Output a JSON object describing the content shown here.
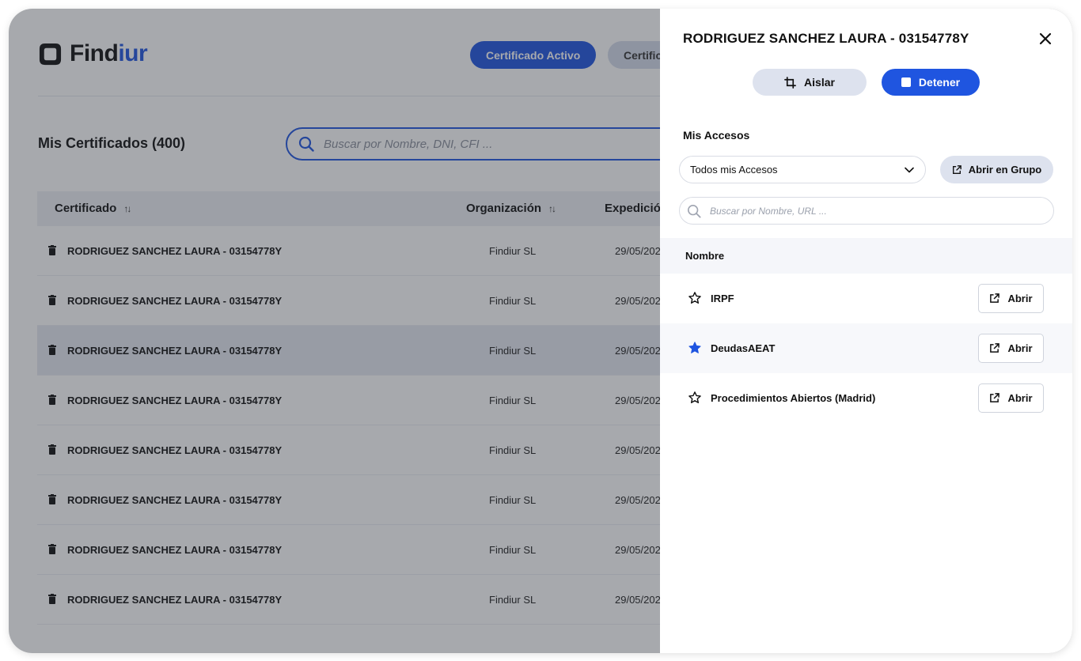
{
  "app": {
    "logo_prefix": "Find",
    "logo_suffix": "iur",
    "tabs": [
      "Certificado Activo",
      "Certific"
    ],
    "page_title": "Mis Certificados (400)",
    "search_placeholder": "Buscar por Nombre, DNI, CFI ...",
    "columns": [
      "Certificado",
      "Organización",
      "Expedición"
    ],
    "rows": [
      {
        "name": "RODRIGUEZ SANCHEZ LAURA - 03154778Y",
        "org": "Findiur SL",
        "date": "29/05/202"
      },
      {
        "name": "RODRIGUEZ SANCHEZ LAURA - 03154778Y",
        "org": "Findiur SL",
        "date": "29/05/202"
      },
      {
        "name": "RODRIGUEZ SANCHEZ LAURA - 03154778Y",
        "org": "Findiur SL",
        "date": "29/05/202"
      },
      {
        "name": "RODRIGUEZ SANCHEZ LAURA - 03154778Y",
        "org": "Findiur SL",
        "date": "29/05/202"
      },
      {
        "name": "RODRIGUEZ SANCHEZ LAURA - 03154778Y",
        "org": "Findiur SL",
        "date": "29/05/202"
      },
      {
        "name": "RODRIGUEZ SANCHEZ LAURA - 03154778Y",
        "org": "Findiur SL",
        "date": "29/05/202"
      },
      {
        "name": "RODRIGUEZ SANCHEZ LAURA - 03154778Y",
        "org": "Findiur SL",
        "date": "29/05/202"
      },
      {
        "name": "RODRIGUEZ SANCHEZ LAURA - 03154778Y",
        "org": "Findiur SL",
        "date": "29/05/202"
      }
    ]
  },
  "drawer": {
    "title": "RODRIGUEZ SANCHEZ LAURA - 03154778Y",
    "isolate_label": "Aislar",
    "stop_label": "Detener",
    "section_title": "Mis Accesos",
    "filter_value": "Todos mis Accesos",
    "open_group_label": "Abrir en Grupo",
    "search_placeholder": "Buscar por Nombre, URL ...",
    "list_header": "Nombre",
    "open_label": "Abrir",
    "accesses": [
      {
        "name": "IRPF",
        "favorite": false
      },
      {
        "name": "DeudasAEAT",
        "favorite": true
      },
      {
        "name": "Procedimientos Abiertos (Madrid)",
        "favorite": false
      }
    ]
  },
  "colors": {
    "accent": "#1f55e0",
    "overlay": "rgba(45,50,60,0.42)",
    "secondary_button": "#dde2ee"
  },
  "icons": [
    "logo-icon",
    "search-icon",
    "sort-icon",
    "trash-icon",
    "close-icon",
    "crop-icon",
    "stop-icon",
    "chevron-down-icon",
    "external-link-icon",
    "star-outline-icon",
    "star-filled-icon"
  ]
}
